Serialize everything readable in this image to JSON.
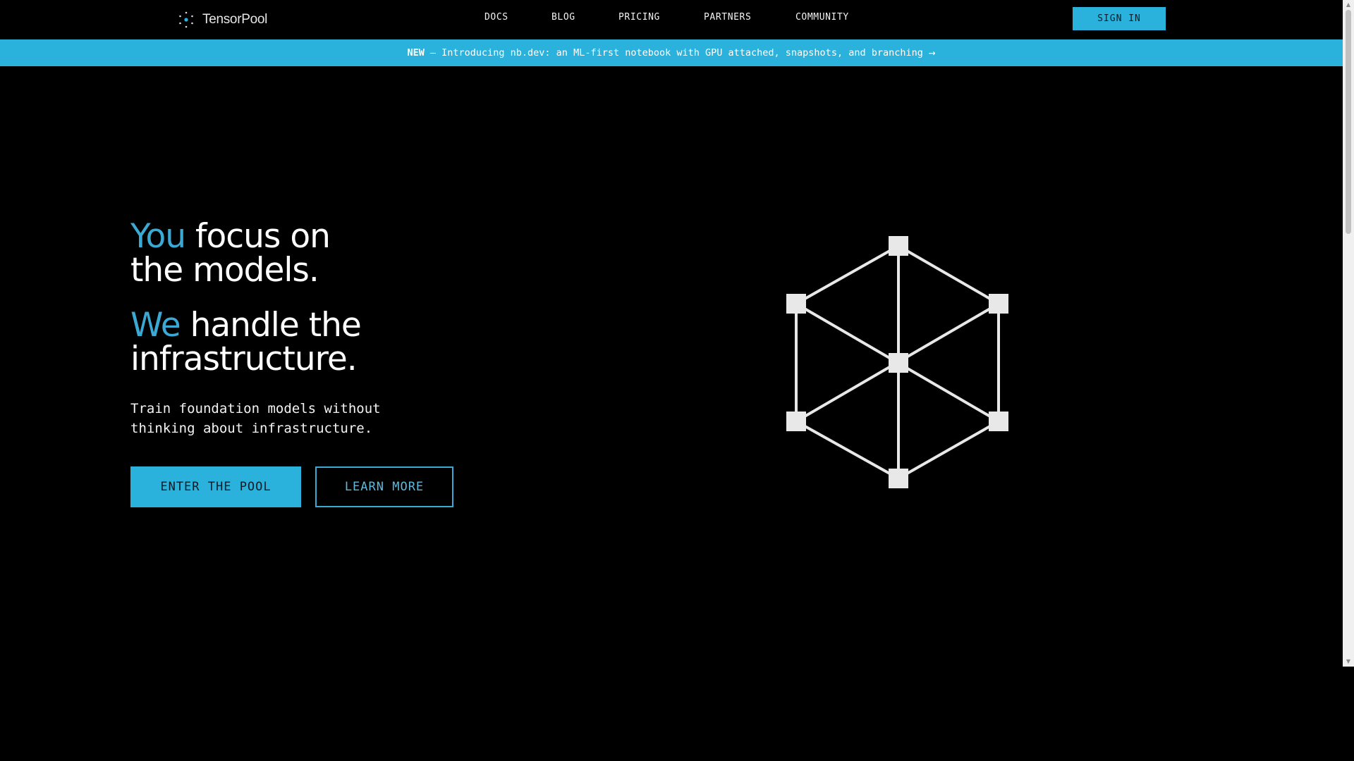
{
  "nav": {
    "brand": "TensorPool",
    "links": [
      {
        "label": "DOCS"
      },
      {
        "label": "BLOG"
      },
      {
        "label": "PRICING"
      },
      {
        "label": "PARTNERS"
      },
      {
        "label": "COMMUNITY"
      }
    ],
    "signin_label": "SIGN IN"
  },
  "announcement": {
    "badge": "NEW",
    "text": "— Introducing nb.dev: an ML-first notebook with GPU attached, snapshots, and branching",
    "arrow": "→"
  },
  "hero": {
    "line1_accent": "You",
    "line1_rest": " focus on",
    "line1_second": "the models.",
    "line2_accent": "We",
    "line2_rest": " handle the",
    "line2_second": "infrastructure.",
    "subtext": "Train foundation models without thinking about infrastructure.",
    "primary_cta": "ENTER THE POOL",
    "secondary_cta": "LEARN MORE"
  },
  "colors": {
    "accent": "#2ab2dc",
    "accent_text": "#3aa9d4",
    "background": "#000000",
    "node": "#e8e8e8"
  },
  "icons": {
    "brand": "tensorpool-dots-logo-icon",
    "graphic": "hexagon-network-graph-icon"
  }
}
